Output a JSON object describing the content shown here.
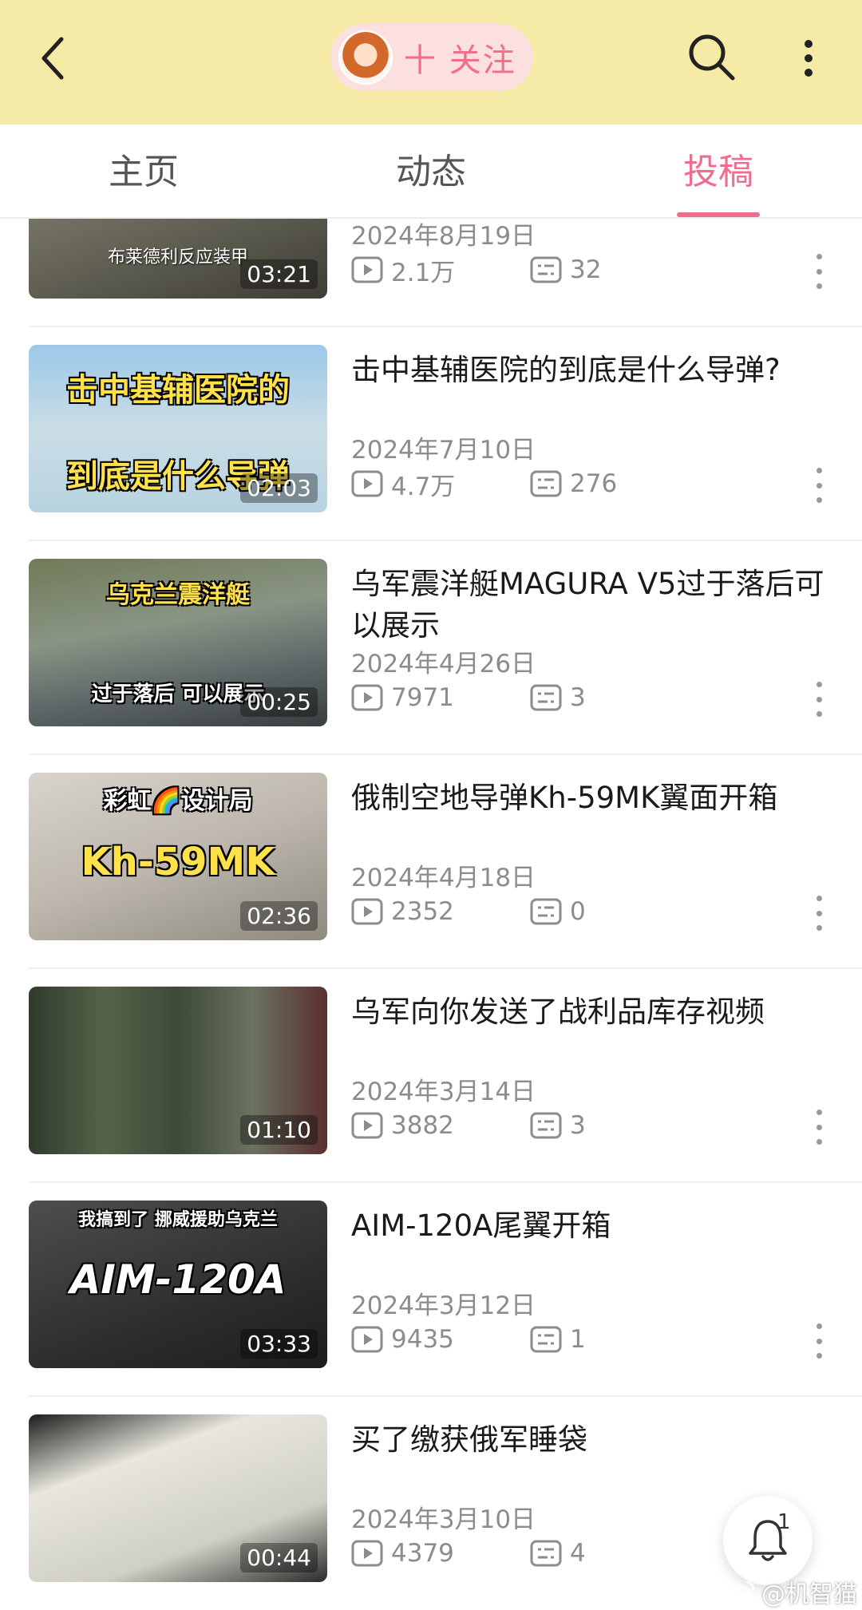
{
  "header": {
    "follow_label": "十 关注",
    "bg_color": "#f6eba6",
    "accent_color": "#ee6e8f"
  },
  "tabs": [
    {
      "label": "主页",
      "active": false
    },
    {
      "label": "动态",
      "active": false
    },
    {
      "label": "投稿",
      "active": true
    }
  ],
  "videos": [
    {
      "thumb_caption": "布莱德利反应装甲",
      "thumb_sub": "",
      "duration": "03:21",
      "title": "",
      "date": "2024年8月19日",
      "views": "2.1万",
      "comments": "32"
    },
    {
      "thumb_caption": "击中基辅医院的",
      "thumb_sub": "到底是什么导弹",
      "duration": "02:03",
      "title": "击中基辅医院的到底是什么导弹?",
      "date": "2024年7月10日",
      "views": "4.7万",
      "comments": "276"
    },
    {
      "thumb_caption": "乌克兰震洋艇",
      "thumb_sub": "过于落后 可以展示",
      "duration": "00:25",
      "title": "乌军震洋艇MAGURA V5过于落后可以展示",
      "date": "2024年4月26日",
      "views": "7971",
      "comments": "3"
    },
    {
      "thumb_caption": "彩虹🌈设计局",
      "thumb_sub": "Kh-59MK",
      "duration": "02:36",
      "title": "俄制空地导弹Kh-59MK翼面开箱",
      "date": "2024年4月18日",
      "views": "2352",
      "comments": "0"
    },
    {
      "thumb_caption": "",
      "thumb_sub": "",
      "duration": "01:10",
      "title": "乌军向你发送了战利品库存视频",
      "date": "2024年3月14日",
      "views": "3882",
      "comments": "3"
    },
    {
      "thumb_caption": "我搞到了 挪威援助乌克兰",
      "thumb_sub": "AIM-120A",
      "duration": "03:33",
      "title": "AIM-120A尾翼开箱",
      "date": "2024年3月12日",
      "views": "9435",
      "comments": "1"
    },
    {
      "thumb_caption": "",
      "thumb_sub": "",
      "duration": "00:44",
      "title": "买了缴获俄军睡袋",
      "date": "2024年3月10日",
      "views": "4379",
      "comments": "4"
    }
  ],
  "fab": {
    "badge": "1"
  },
  "watermark": "@机智猫"
}
